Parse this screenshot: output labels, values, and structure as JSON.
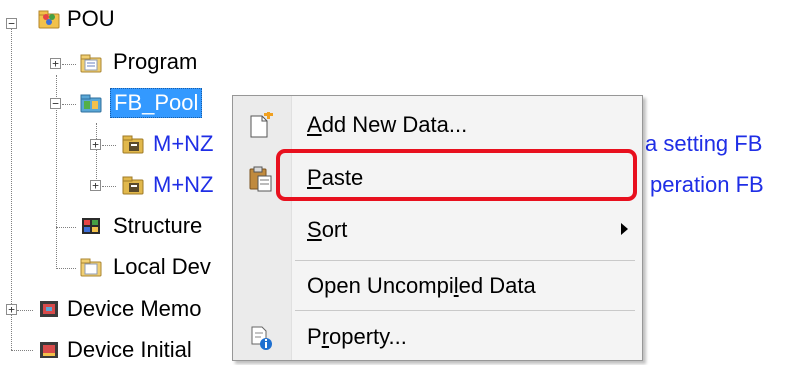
{
  "tree": {
    "pou": "POU",
    "program": "Program",
    "fb_pool": "FB_Pool",
    "fb1_prefix": "M+NZ",
    "fb1_suffix": "a setting FB",
    "fb2_prefix": "M+NZ",
    "fb2_suffix": "peration FB",
    "structured": "Structure",
    "local_device": "Local Dev",
    "device_memory": "Device Memo",
    "device_initial": "Device Initial"
  },
  "context_menu": {
    "items": [
      {
        "before": "",
        "accel": "A",
        "after": "dd New Data..."
      },
      {
        "before": "",
        "accel": "P",
        "after": "aste"
      },
      {
        "before": "",
        "accel": "S",
        "after": "ort"
      },
      {
        "before": "Open Uncompi",
        "accel": "l",
        "after": "ed Data"
      },
      {
        "before": "P",
        "accel": "r",
        "after": "operty..."
      }
    ]
  },
  "icons": {
    "add_new_data": "new-document-icon",
    "paste": "paste-icon",
    "property": "property-icon",
    "submenu": "submenu-arrow-icon"
  },
  "colors": {
    "selection": "#3399ff",
    "link_text": "#1f2ee6",
    "highlight": "#e8101e"
  }
}
